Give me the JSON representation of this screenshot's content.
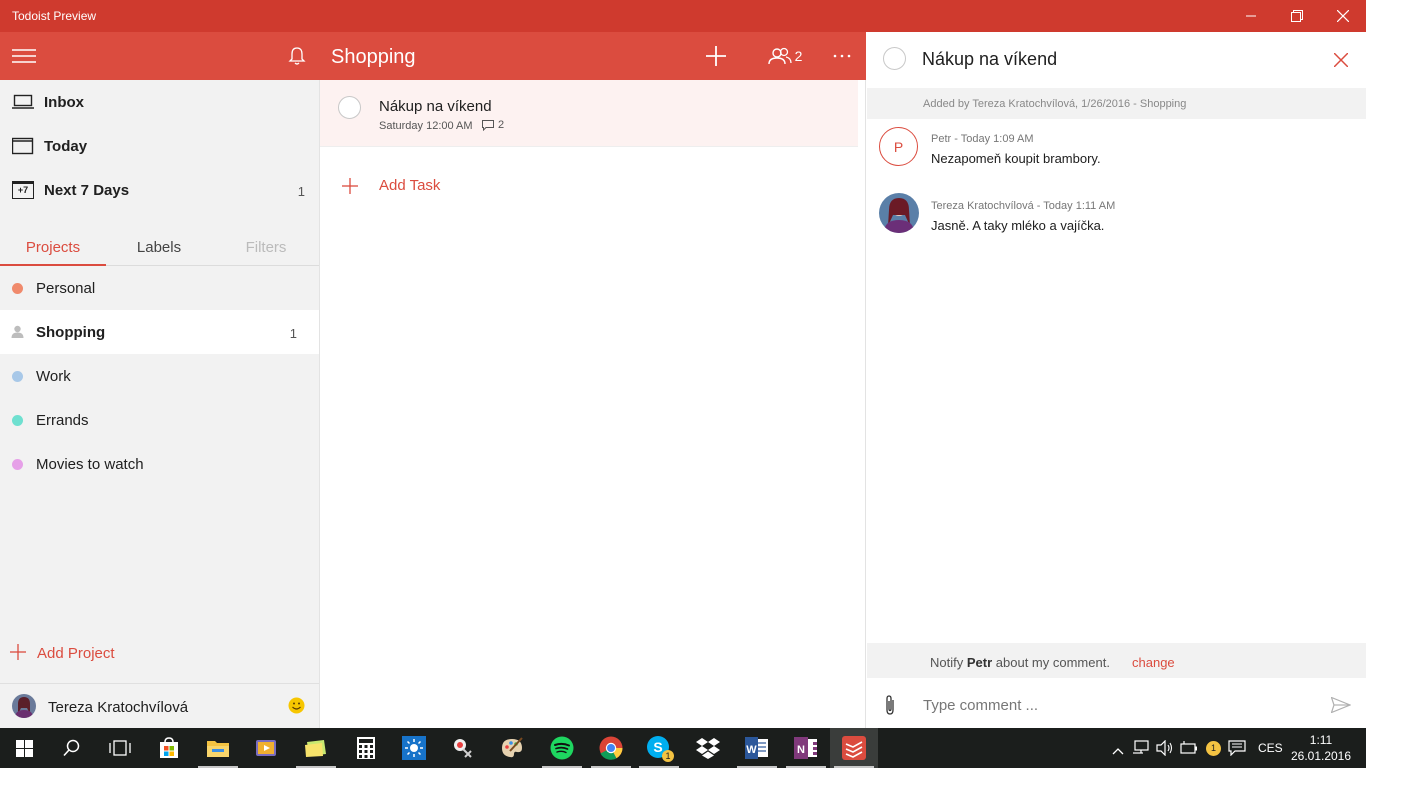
{
  "window": {
    "title": "Todoist Preview"
  },
  "header": {
    "project_title": "Shopping",
    "members_count": "2"
  },
  "sidebar": {
    "nav": [
      {
        "label": "Inbox",
        "count": ""
      },
      {
        "label": "Today",
        "count": ""
      },
      {
        "label": "Next 7 Days",
        "count": "1",
        "icon_text": "+7"
      }
    ],
    "tabs": [
      "Projects",
      "Labels",
      "Filters"
    ],
    "projects": [
      {
        "label": "Personal",
        "count": "",
        "color": "#f08a6c"
      },
      {
        "label": "Shopping",
        "count": "1",
        "color": "#bdbdbd"
      },
      {
        "label": "Work",
        "count": "",
        "color": "#a8c8e8"
      },
      {
        "label": "Errands",
        "count": "",
        "color": "#6fe0d0"
      },
      {
        "label": "Movies to watch",
        "count": "",
        "color": "#e6a0e8"
      }
    ],
    "add_project_label": "Add Project",
    "user_name": "Tereza Kratochvílová"
  },
  "tasks": {
    "items": [
      {
        "name": "Nákup na víkend",
        "due": "Saturday 12:00 AM",
        "comments": "2"
      }
    ],
    "add_task_label": "Add Task"
  },
  "detail": {
    "title": "Nákup na víkend",
    "added_by": "Added by Tereza Kratochvílová, 1/26/2016 - Shopping",
    "comments": [
      {
        "author": "Petr",
        "time": "Today 1:09 AM",
        "meta": "Petr  -  Today 1:09 AM",
        "text": "Nezapomeň koupit brambory.",
        "initial": "P"
      },
      {
        "author": "Tereza Kratochvílová",
        "time": "Today 1:11 AM",
        "meta": "Tereza Kratochvílová  -  Today 1:11 AM",
        "text": "Jasně. A taky mléko a vajíčka."
      }
    ],
    "notify_prefix": "Notify",
    "notify_name": "Petr",
    "notify_suffix": "about my comment.",
    "notify_change": "change",
    "comment_placeholder": "Type comment ..."
  },
  "taskbar": {
    "lang": "CES",
    "time": "1:11",
    "date": "26.01.2016",
    "skype_badge": "1",
    "tray_badge": "1"
  },
  "colors": {
    "brand": "#db4c3f",
    "titlebar": "#cf3a2e"
  }
}
